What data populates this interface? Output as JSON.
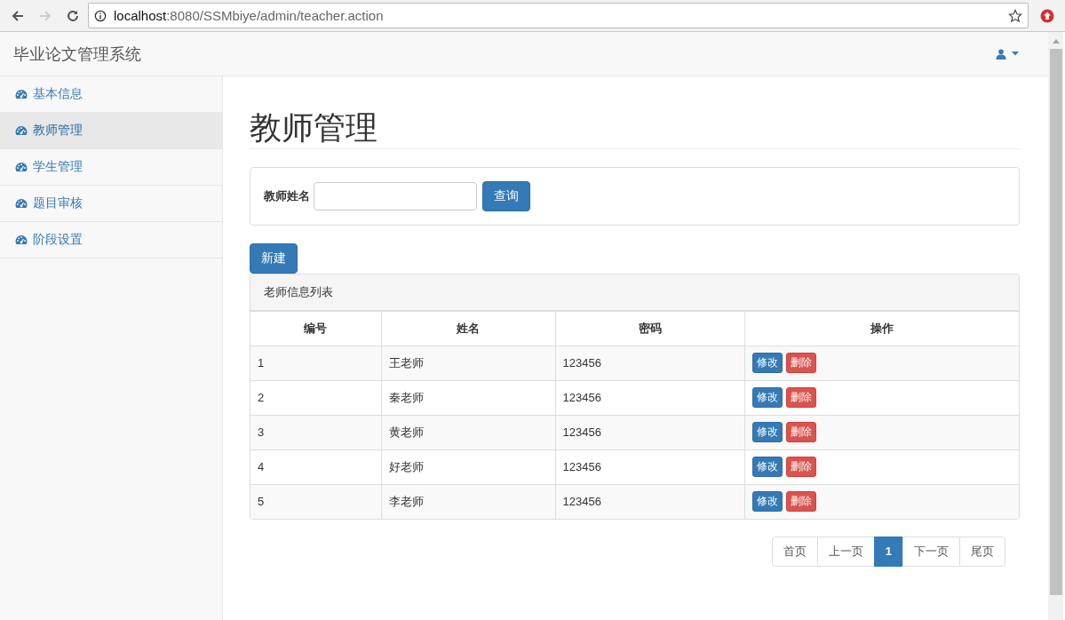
{
  "browser": {
    "url_host": "localhost",
    "url_rest": ":8080/SSMbiye/admin/teacher.action"
  },
  "navbar": {
    "brand": "毕业论文管理系统"
  },
  "sidebar": {
    "items": [
      {
        "label": "基本信息",
        "selected": false
      },
      {
        "label": "教师管理",
        "selected": true
      },
      {
        "label": "学生管理",
        "selected": false
      },
      {
        "label": "题目审核",
        "selected": false
      },
      {
        "label": "阶段设置",
        "selected": false
      }
    ]
  },
  "page": {
    "title": "教师管理"
  },
  "search": {
    "label": "教师姓名",
    "button": "查询"
  },
  "new_button": "新建",
  "table": {
    "title": "老师信息列表",
    "columns": [
      "编号",
      "姓名",
      "密码",
      "操作"
    ],
    "rows": [
      {
        "id": "1",
        "name": "王老师",
        "password": "123456",
        "edit": "修改",
        "delete": "删除"
      },
      {
        "id": "2",
        "name": "秦老师",
        "password": "123456",
        "edit": "修改",
        "delete": "删除"
      },
      {
        "id": "3",
        "name": "黄老师",
        "password": "123456",
        "edit": "修改",
        "delete": "删除"
      },
      {
        "id": "4",
        "name": "好老师",
        "password": "123456",
        "edit": "修改",
        "delete": "删除"
      },
      {
        "id": "5",
        "name": "李老师",
        "password": "123456",
        "edit": "修改",
        "delete": "删除"
      }
    ]
  },
  "pagination": [
    {
      "label": "首页",
      "selected": false
    },
    {
      "label": "上一页",
      "selected": false
    },
    {
      "label": "1",
      "selected": true
    },
    {
      "label": "下一页",
      "selected": false
    },
    {
      "label": "尾页",
      "selected": false
    }
  ]
}
